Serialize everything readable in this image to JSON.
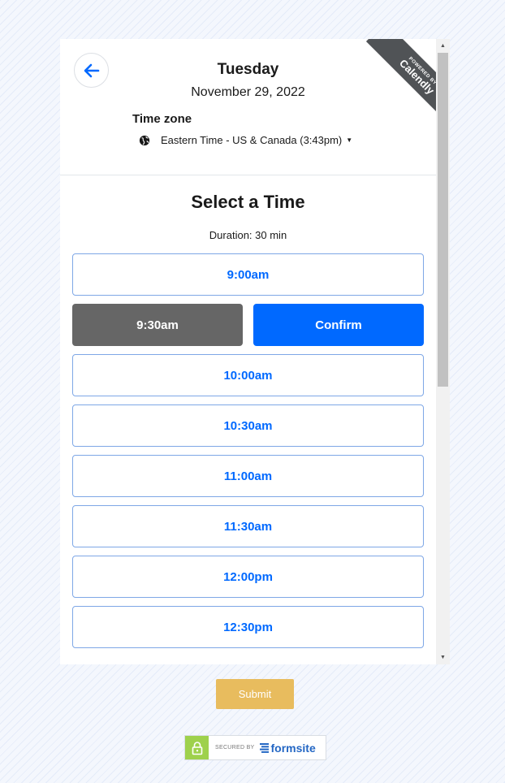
{
  "header": {
    "day": "Tuesday",
    "date": "November 29, 2022",
    "timezone_label": "Time zone",
    "timezone_value": "Eastern Time - US & Canada (3:43pm)"
  },
  "ribbon": {
    "powered_by": "POWERED BY",
    "brand": "Calendly"
  },
  "main": {
    "title": "Select a Time",
    "duration": "Duration: 30 min",
    "slots_before": [
      "9:00am"
    ],
    "selected_slot": "9:30am",
    "confirm_label": "Confirm",
    "slots_after": [
      "10:00am",
      "10:30am",
      "11:00am",
      "11:30am",
      "12:00pm",
      "12:30pm"
    ]
  },
  "footer": {
    "submit_label": "Submit",
    "secured_by": "SECURED BY",
    "secured_brand": "formsite"
  },
  "colors": {
    "accent": "#0069ff",
    "selected": "#666666",
    "submit": "#e8bc5e",
    "ribbon": "#505356"
  },
  "icons": [
    "arrow-left-icon",
    "globe-icon",
    "caret-down-icon",
    "lock-icon"
  ]
}
